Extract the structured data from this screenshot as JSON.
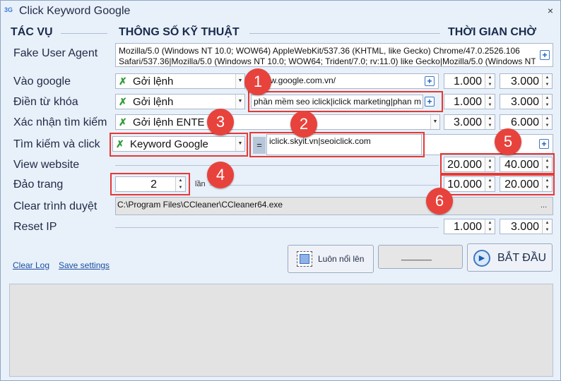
{
  "window": {
    "title": "Click Keyword Google",
    "icon_text": "3G",
    "close": "×"
  },
  "headers": {
    "tac_vu": "TÁC VỤ",
    "thong_so": "THÔNG SỐ KỸ THUẬT",
    "thoi_gian": "THỜI GIAN CHỜ"
  },
  "rows": {
    "fake_ua": {
      "label": "Fake User Agent",
      "value_line1": "Mozilla/5.0 (Windows NT 10.0; WOW64) AppleWebKit/537.36 (KHTML, like Gecko) Chrome/47.0.2526.106",
      "value_line2": "Safari/537.36|Mozilla/5.0 (Windows NT 10.0; WOW64; Trident/7.0; rv:11.0) like Gecko|Mozilla/5.0 (Windows NT"
    },
    "vao_google": {
      "label": "Vào google",
      "combo": "Gởi lệnh",
      "url": "://www.google.com.vn/",
      "t1": "1.000",
      "t2": "3.000"
    },
    "dien_tu_khoa": {
      "label": "Điền từ khóa",
      "combo": "Gởi lệnh",
      "keywords": "phần mềm seo iclick|iclick marketing|phan m",
      "t1": "1.000",
      "t2": "3.000"
    },
    "xac_nhan": {
      "label": "Xác nhận tìm kiếm",
      "combo": "Gởi lệnh ENTE",
      "t1": "3.000",
      "t2": "6.000"
    },
    "tim_kiem": {
      "label": "Tìm kiếm và click",
      "combo": "Keyword Google",
      "eq": "=",
      "domains": "iclick.skyit.vn|seoiclick.com"
    },
    "view_website": {
      "label": "View website",
      "t1": "20.000",
      "t2": "40.000"
    },
    "dao_trang": {
      "label": "Đảo trang",
      "value": "2",
      "unit": "lần",
      "t1": "10.000",
      "t2": "20.000"
    },
    "clear_browser": {
      "label": "Clear trình duyệt",
      "path": "C:\\Program Files\\CCleaner\\CCleaner64.exe",
      "browse": "..."
    },
    "reset_ip": {
      "label": "Reset IP",
      "t1": "1.000",
      "t2": "3.000"
    }
  },
  "badges": [
    "1",
    "2",
    "3",
    "4",
    "5",
    "6"
  ],
  "links": {
    "clear_log": "Clear Log",
    "save_settings": "Save settings"
  },
  "buttons": {
    "pin": "Luôn nổi lên",
    "blank": "_______",
    "start": "BẮT ĐẦU"
  },
  "colors": {
    "badge": "#e8423c",
    "highlight": "#e53935",
    "link": "#1a4ea0"
  }
}
